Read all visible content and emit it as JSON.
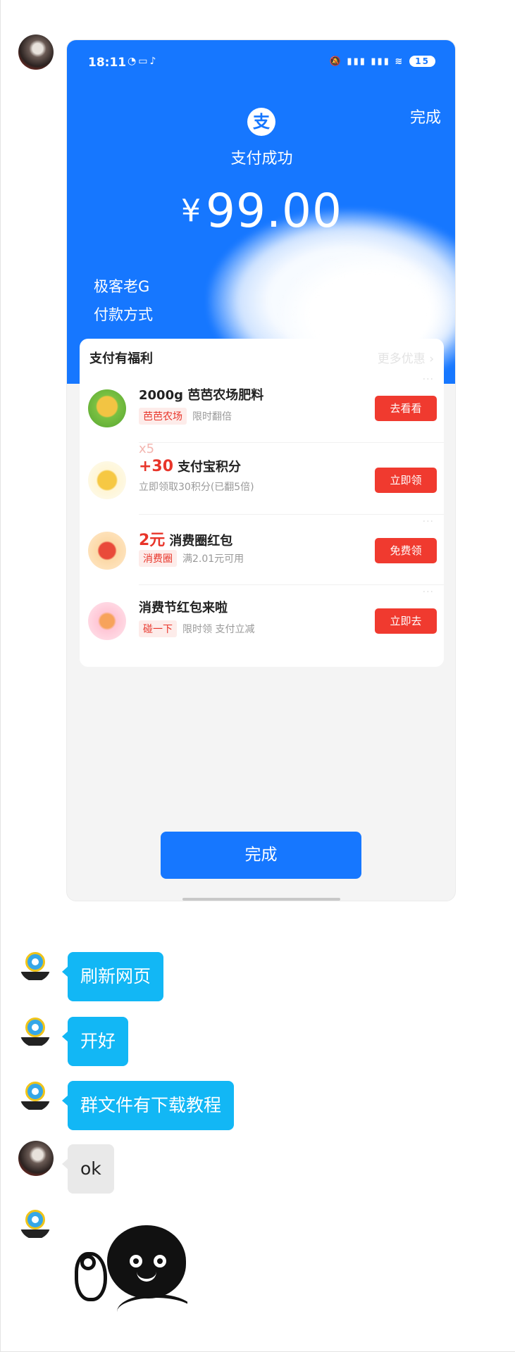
{
  "phone": {
    "status": {
      "time": "18:11",
      "left_icons": "◔▭♪",
      "right_icons": "🔕 ▮▮▮ ▮▮▮ ≋",
      "battery": "15"
    },
    "done_top": "完成",
    "logo_char": "支",
    "success_text": "支付成功",
    "currency": "¥",
    "amount": "99.00",
    "payee": "极客老G",
    "pay_method_label": "付款方式",
    "benefits": {
      "title": "支付有福利",
      "more": "更多优惠 ›",
      "items": [
        {
          "name": "2000g 芭芭农场肥料",
          "tag": "芭芭农场",
          "sub": "限时翻倍",
          "button": "去看看",
          "icon": "fertilizer-icon"
        },
        {
          "x5": "x5",
          "highlight": "+30",
          "name": "支付宝积分",
          "sub": "立即领取30积分(已翻5倍)",
          "button": "立即领",
          "icon": "points-icon"
        },
        {
          "highlight": "2元",
          "name": "消费圈红包",
          "tag": "消费圈",
          "sub": "满2.01元可用",
          "button": "免费领",
          "icon": "red-packet-icon"
        },
        {
          "name": "消费节红包来啦",
          "tag": "碰一下",
          "sub": "限时领 支付立减",
          "button": "立即去",
          "icon": "festival-icon"
        }
      ]
    },
    "done_button": "完成"
  },
  "chat": {
    "messages": [
      {
        "text": "刷新网页",
        "sender": "bot"
      },
      {
        "text": "开好",
        "sender": "bot"
      },
      {
        "text": "群文件有下载教程",
        "sender": "bot"
      },
      {
        "text": "ok",
        "sender": "user"
      }
    ],
    "sticker": "ok-hand-sticker"
  },
  "colors": {
    "alipay_blue": "#1677ff",
    "bubble_blue": "#12b7f5",
    "accent_red": "#f03a2f"
  }
}
